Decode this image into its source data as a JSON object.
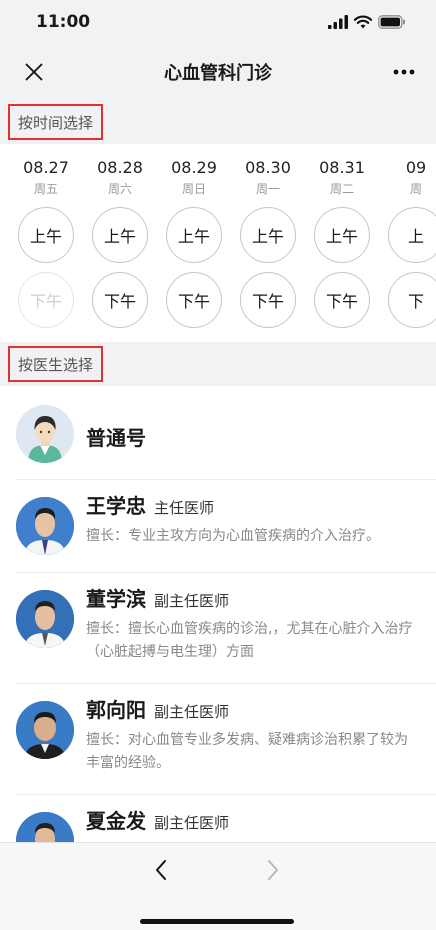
{
  "status_bar": {
    "time": "11:00"
  },
  "nav": {
    "title": "心血管科门诊"
  },
  "sections": {
    "by_time": "按时间选择",
    "by_doctor": "按医生选择"
  },
  "dates": [
    {
      "date": "08.27",
      "weekday": "周五",
      "am": "上午",
      "pm": "下午",
      "pm_disabled": true
    },
    {
      "date": "08.28",
      "weekday": "周六",
      "am": "上午",
      "pm": "下午",
      "pm_disabled": false
    },
    {
      "date": "08.29",
      "weekday": "周日",
      "am": "上午",
      "pm": "下午",
      "pm_disabled": false
    },
    {
      "date": "08.30",
      "weekday": "周一",
      "am": "上午",
      "pm": "下午",
      "pm_disabled": false
    },
    {
      "date": "08.31",
      "weekday": "周二",
      "am": "上午",
      "pm": "下午",
      "pm_disabled": false
    },
    {
      "date": "09",
      "weekday": "周",
      "am": "上",
      "pm": "下",
      "pm_disabled": false
    }
  ],
  "doctors": [
    {
      "name": "普通号",
      "title": "",
      "specialty": "",
      "avatar": "generic-doctor-icon"
    },
    {
      "name": "王学忠",
      "title": "主任医师",
      "specialty": "擅长：专业主攻方向为心血管疾病的介入治疗。",
      "avatar": "doctor-photo"
    },
    {
      "name": "董学滨",
      "title": "副主任医师",
      "specialty": "擅长：擅长心血管疾病的诊治,，尤其在心脏介入治疗（心脏起搏与电生理）方面",
      "avatar": "doctor-photo"
    },
    {
      "name": "郭向阳",
      "title": "副主任医师",
      "specialty": "擅长：对心血管专业多发病、疑难病诊治积累了较为丰富的经验。",
      "avatar": "doctor-photo"
    },
    {
      "name": "夏金发",
      "title": "副主任医师",
      "specialty": "",
      "avatar": "doctor-photo"
    }
  ],
  "colors": {
    "highlight_border": "#e0322f",
    "background_gray": "#f2f2f4"
  }
}
